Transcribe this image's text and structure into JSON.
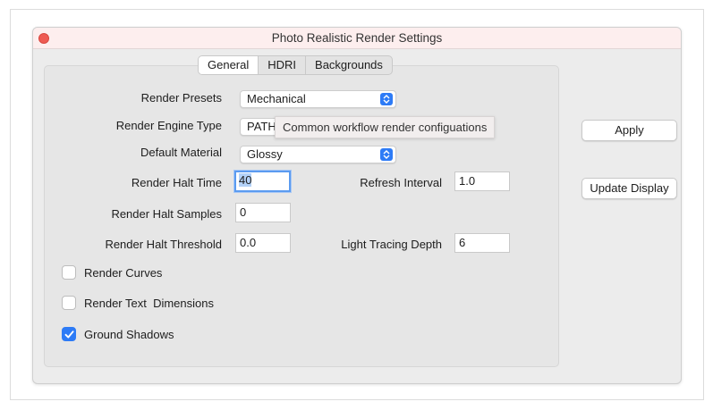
{
  "window": {
    "title": "Photo Realistic Render Settings"
  },
  "tabs": [
    {
      "label": "General",
      "active": true
    },
    {
      "label": "HDRI",
      "active": false
    },
    {
      "label": "Backgrounds",
      "active": false
    }
  ],
  "general": {
    "render_presets": {
      "label": "Render Presets",
      "value": "Mechanical"
    },
    "render_engine_type": {
      "label": "Render Engine Type",
      "value": "PATH"
    },
    "default_material": {
      "label": "Default Material",
      "value": "Glossy"
    },
    "render_halt_time": {
      "label": "Render Halt Time",
      "value": "40"
    },
    "refresh_interval": {
      "label": "Refresh Interval",
      "value": "1.0"
    },
    "render_halt_samples": {
      "label": "Render Halt Samples",
      "value": "0"
    },
    "render_halt_threshold": {
      "label": "Render Halt Threshold",
      "value": "0.0"
    },
    "light_tracing_depth": {
      "label": "Light Tracing Depth",
      "value": "6"
    },
    "render_curves": {
      "label": "Render Curves",
      "checked": false
    },
    "render_text_dimensions": {
      "label": "Render Text  Dimensions",
      "checked": false
    },
    "ground_shadows": {
      "label": "Ground Shadows",
      "checked": true
    }
  },
  "tooltip": {
    "text": "Common workflow render configuations"
  },
  "buttons": {
    "apply": "Apply",
    "update_display": "Update Display"
  },
  "colors": {
    "accent": "#2d7bf6",
    "close": "#ee5a52",
    "titlebar": "#fdeeee",
    "focus_ring": "#5b9bf0"
  }
}
